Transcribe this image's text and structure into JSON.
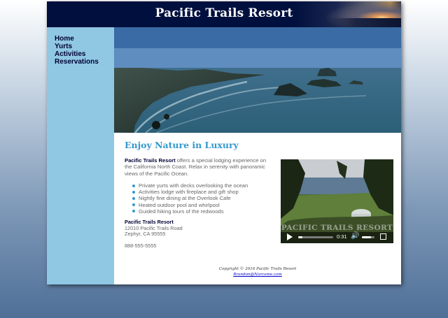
{
  "header": {
    "title": "Pacific Trails Resort"
  },
  "nav": {
    "items": [
      {
        "label": "Home"
      },
      {
        "label": "Yurts"
      },
      {
        "label": "Activities"
      },
      {
        "label": "Reservations"
      }
    ]
  },
  "main": {
    "heading": "Enjoy Nature in Luxury",
    "intro_brand": "Pacific Trails Resort",
    "intro_text": " offers a special lodging experience on the California North Coast. Relax in serenity with panoramic views of the Pacific Ocean.",
    "features": [
      "Private yurts with decks overlooking the ocean",
      "Activities lodge with fireplace and gift shop",
      "Nightly fine dining at the Overlook Cafe",
      "Heated outdoor pool and whirlpool",
      "Guided hiking tours of the redwoods"
    ],
    "contact": {
      "name": "Pacific Trails Resort",
      "street": "12010 Pacific Trails Road",
      "city": "Zephyr, CA 95555"
    },
    "phone": "888-555-5555"
  },
  "video": {
    "overlay_text": "PACIFIC TRAILS RESORT",
    "time": "0:31",
    "progress": 0.12,
    "volume": 0.7
  },
  "footer": {
    "copyright": "Copyright © 2016 Pacific Trails Resort",
    "email": "Brandon@Narcome.com"
  },
  "colors": {
    "header_bg": "#000f3d",
    "nav_bg": "#90c7e3",
    "heading": "#3399cc",
    "dark_text": "#000033",
    "body_text": "#666666"
  }
}
